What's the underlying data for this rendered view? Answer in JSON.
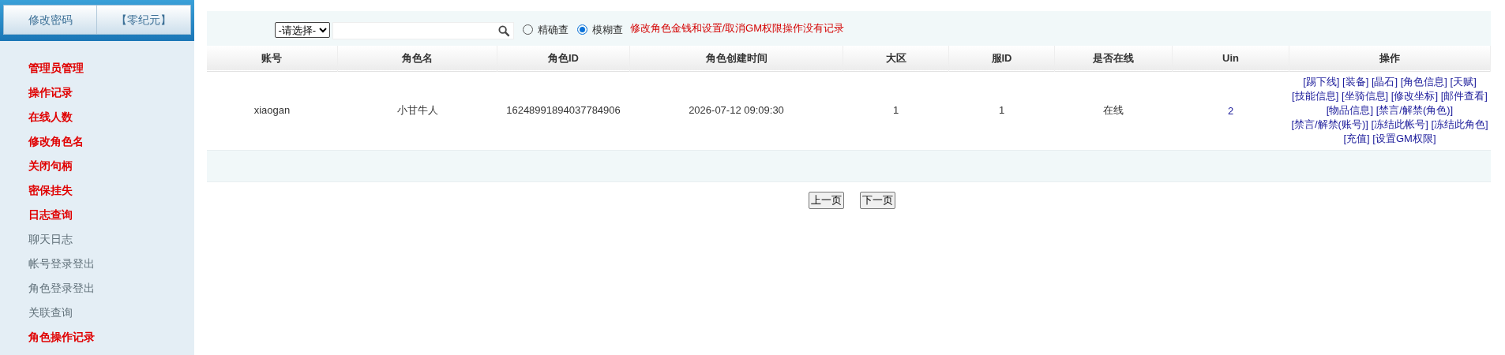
{
  "sidebar": {
    "top_buttons": [
      "修改密码",
      "【零纪元】"
    ],
    "items": [
      {
        "label": "管理员管理",
        "kind": "category"
      },
      {
        "label": "操作记录",
        "kind": "category"
      },
      {
        "label": "在线人数",
        "kind": "category"
      },
      {
        "label": "修改角色名",
        "kind": "category"
      },
      {
        "label": "关闭句柄",
        "kind": "category"
      },
      {
        "label": "密保挂失",
        "kind": "category"
      },
      {
        "label": "日志查询",
        "kind": "category"
      },
      {
        "label": "聊天日志",
        "kind": "link"
      },
      {
        "label": "帐号登录登出",
        "kind": "link"
      },
      {
        "label": "角色登录登出",
        "kind": "link"
      },
      {
        "label": "关联查询",
        "kind": "link"
      },
      {
        "label": "角色操作记录",
        "kind": "category"
      }
    ]
  },
  "search": {
    "select": "-请选择-",
    "modes": [
      {
        "label": "精确查",
        "selected": false
      },
      {
        "label": "模糊查",
        "selected": true
      }
    ],
    "notice": "修改角色金钱和设置/取消GM权限操作没有记录"
  },
  "table": {
    "columns": [
      "账号",
      "角色名",
      "角色ID",
      "角色创建时间",
      "大区",
      "服ID",
      "是否在线",
      "Uin",
      "操作"
    ],
    "rows": [
      {
        "account": "xiaogan",
        "name": "小甘牛人",
        "role_id": "16248991894037784906",
        "created": "2026-07-12 09:09:30",
        "region": "1",
        "server_id": "1",
        "online": "在线",
        "uin": "2",
        "actions": [
          "[踢下线]",
          "[装备]",
          "[晶石]",
          "[角色信息]",
          "[天赋]",
          "[技能信息]",
          "[坐骑信息]",
          "[修改坐标]",
          "[邮件查看]",
          "[物品信息]",
          "[禁言/解禁(角色)]",
          "[禁言/解禁(账号)]",
          "[冻结此帐号]",
          "[冻结此角色]",
          "[充值]",
          "[设置GM权限]"
        ]
      }
    ]
  },
  "pagination": [
    "上一页",
    "下一页"
  ]
}
